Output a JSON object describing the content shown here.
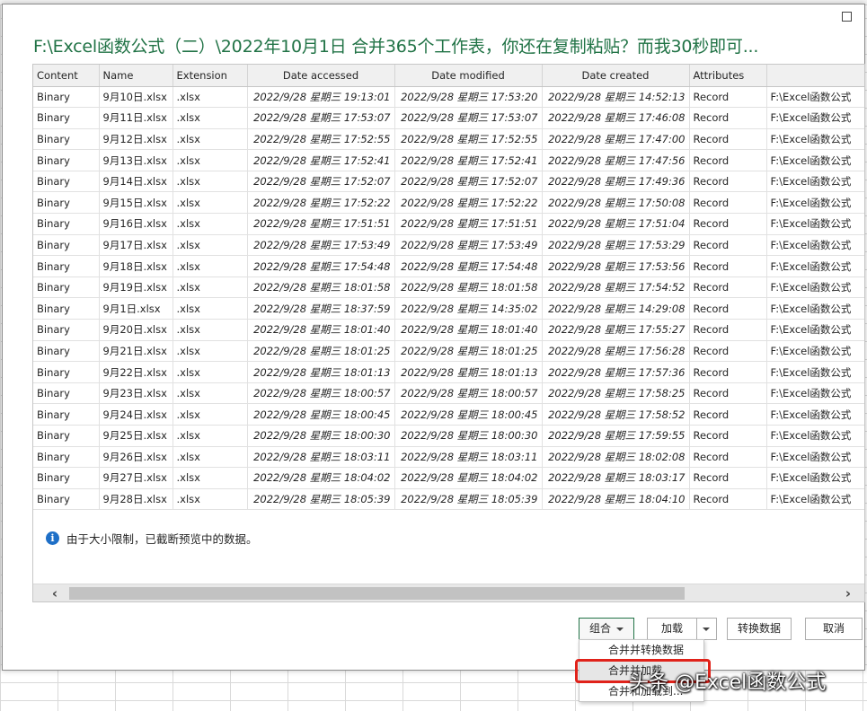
{
  "dialog": {
    "title": "F:\\Excel函数公式（二）\\2022年10月1日 合并365个工作表，你还在复制粘贴？而我30秒即可..."
  },
  "table": {
    "columns": [
      "Content",
      "Name",
      "Extension",
      "Date accessed",
      "Date modified",
      "Date created",
      "Attributes",
      ""
    ],
    "rows": [
      [
        "Binary",
        "9月10日.xlsx",
        ".xlsx",
        "2022/9/28 星期三 19:13:01",
        "2022/9/28 星期三 17:53:20",
        "2022/9/28 星期三 14:52:13",
        "Record",
        "F:\\Excel函数公式"
      ],
      [
        "Binary",
        "9月11日.xlsx",
        ".xlsx",
        "2022/9/28 星期三 17:53:07",
        "2022/9/28 星期三 17:53:07",
        "2022/9/28 星期三 17:46:08",
        "Record",
        "F:\\Excel函数公式"
      ],
      [
        "Binary",
        "9月12日.xlsx",
        ".xlsx",
        "2022/9/28 星期三 17:52:55",
        "2022/9/28 星期三 17:52:55",
        "2022/9/28 星期三 17:47:00",
        "Record",
        "F:\\Excel函数公式"
      ],
      [
        "Binary",
        "9月13日.xlsx",
        ".xlsx",
        "2022/9/28 星期三 17:52:41",
        "2022/9/28 星期三 17:52:41",
        "2022/9/28 星期三 17:47:56",
        "Record",
        "F:\\Excel函数公式"
      ],
      [
        "Binary",
        "9月14日.xlsx",
        ".xlsx",
        "2022/9/28 星期三 17:52:07",
        "2022/9/28 星期三 17:52:07",
        "2022/9/28 星期三 17:49:36",
        "Record",
        "F:\\Excel函数公式"
      ],
      [
        "Binary",
        "9月15日.xlsx",
        ".xlsx",
        "2022/9/28 星期三 17:52:22",
        "2022/9/28 星期三 17:52:22",
        "2022/9/28 星期三 17:50:08",
        "Record",
        "F:\\Excel函数公式"
      ],
      [
        "Binary",
        "9月16日.xlsx",
        ".xlsx",
        "2022/9/28 星期三 17:51:51",
        "2022/9/28 星期三 17:51:51",
        "2022/9/28 星期三 17:51:04",
        "Record",
        "F:\\Excel函数公式"
      ],
      [
        "Binary",
        "9月17日.xlsx",
        ".xlsx",
        "2022/9/28 星期三 17:53:49",
        "2022/9/28 星期三 17:53:49",
        "2022/9/28 星期三 17:53:29",
        "Record",
        "F:\\Excel函数公式"
      ],
      [
        "Binary",
        "9月18日.xlsx",
        ".xlsx",
        "2022/9/28 星期三 17:54:48",
        "2022/9/28 星期三 17:54:48",
        "2022/9/28 星期三 17:53:56",
        "Record",
        "F:\\Excel函数公式"
      ],
      [
        "Binary",
        "9月19日.xlsx",
        ".xlsx",
        "2022/9/28 星期三 18:01:58",
        "2022/9/28 星期三 18:01:58",
        "2022/9/28 星期三 17:54:52",
        "Record",
        "F:\\Excel函数公式"
      ],
      [
        "Binary",
        "9月1日.xlsx",
        ".xlsx",
        "2022/9/28 星期三 18:37:59",
        "2022/9/28 星期三 14:35:02",
        "2022/9/28 星期三 14:29:08",
        "Record",
        "F:\\Excel函数公式"
      ],
      [
        "Binary",
        "9月20日.xlsx",
        ".xlsx",
        "2022/9/28 星期三 18:01:40",
        "2022/9/28 星期三 18:01:40",
        "2022/9/28 星期三 17:55:27",
        "Record",
        "F:\\Excel函数公式"
      ],
      [
        "Binary",
        "9月21日.xlsx",
        ".xlsx",
        "2022/9/28 星期三 18:01:25",
        "2022/9/28 星期三 18:01:25",
        "2022/9/28 星期三 17:56:28",
        "Record",
        "F:\\Excel函数公式"
      ],
      [
        "Binary",
        "9月22日.xlsx",
        ".xlsx",
        "2022/9/28 星期三 18:01:13",
        "2022/9/28 星期三 18:01:13",
        "2022/9/28 星期三 17:57:36",
        "Record",
        "F:\\Excel函数公式"
      ],
      [
        "Binary",
        "9月23日.xlsx",
        ".xlsx",
        "2022/9/28 星期三 18:00:57",
        "2022/9/28 星期三 18:00:57",
        "2022/9/28 星期三 17:58:25",
        "Record",
        "F:\\Excel函数公式"
      ],
      [
        "Binary",
        "9月24日.xlsx",
        ".xlsx",
        "2022/9/28 星期三 18:00:45",
        "2022/9/28 星期三 18:00:45",
        "2022/9/28 星期三 17:58:52",
        "Record",
        "F:\\Excel函数公式"
      ],
      [
        "Binary",
        "9月25日.xlsx",
        ".xlsx",
        "2022/9/28 星期三 18:00:30",
        "2022/9/28 星期三 18:00:30",
        "2022/9/28 星期三 17:59:55",
        "Record",
        "F:\\Excel函数公式"
      ],
      [
        "Binary",
        "9月26日.xlsx",
        ".xlsx",
        "2022/9/28 星期三 18:03:11",
        "2022/9/28 星期三 18:03:11",
        "2022/9/28 星期三 18:02:08",
        "Record",
        "F:\\Excel函数公式"
      ],
      [
        "Binary",
        "9月27日.xlsx",
        ".xlsx",
        "2022/9/28 星期三 18:04:02",
        "2022/9/28 星期三 18:04:02",
        "2022/9/28 星期三 18:03:17",
        "Record",
        "F:\\Excel函数公式"
      ],
      [
        "Binary",
        "9月28日.xlsx",
        ".xlsx",
        "2022/9/28 星期三 18:05:39",
        "2022/9/28 星期三 18:05:39",
        "2022/9/28 星期三 18:04:10",
        "Record",
        "F:\\Excel函数公式"
      ]
    ]
  },
  "info": {
    "icon": "info-icon",
    "text": "由于大小限制，已截断预览中的数据。"
  },
  "buttons": {
    "combine": "组合",
    "load": "加载",
    "transform": "转换数据",
    "cancel": "取消"
  },
  "menu": {
    "items": [
      "合并并转换数据",
      "合并并加载",
      "合并和加载到..."
    ]
  },
  "watermark": "头条 @Excel函数公式",
  "colors": {
    "title_green": "#217346",
    "highlight_red": "#e0221a",
    "info_blue": "#1e6fc7"
  }
}
